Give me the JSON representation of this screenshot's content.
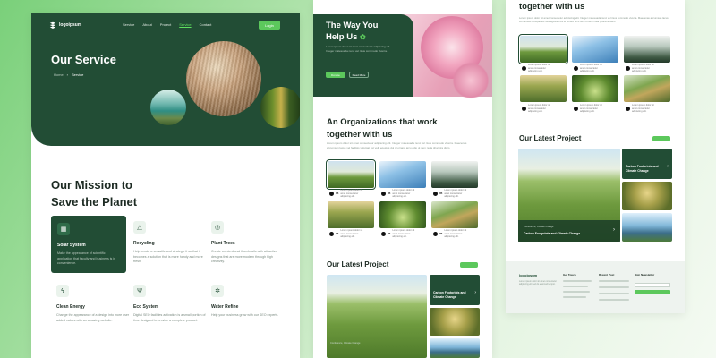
{
  "brand": {
    "name": "logoipsum"
  },
  "nav": {
    "links": [
      "Service",
      "About",
      "Project",
      "Service",
      "Contact"
    ],
    "active_index": 3,
    "cta": "Login"
  },
  "hero1": {
    "title": "Our Service",
    "breadcrumb": [
      "Home",
      "Service"
    ]
  },
  "mission": {
    "title_line1": "Our Mission to",
    "title_line2": "Save the Planet",
    "services": [
      {
        "title": "Solar System",
        "desc": "Make the appearance of scientific application that faculty and business is in convenience.",
        "icon": "solar-panel-icon"
      },
      {
        "title": "Recycling",
        "desc": "Help create a versatile and strategic it so that it becomes a solution that is more handy and more fresh.",
        "icon": "triangle-recycle-icon"
      },
      {
        "title": "Plant Trees",
        "desc": "Create unintentional thumbnails with attractive designs that are more modern through high creativity.",
        "icon": "wifi-tree-icon"
      },
      {
        "title": "Clean Energy",
        "desc": "Change the appearance of a design into more user added values with an amazing website.",
        "icon": "lightning-icon"
      },
      {
        "title": "Eco System",
        "desc": "Digital SEO facilities activation is a small portion of time designed to provide a complete product.",
        "icon": "fork-knife-icon"
      },
      {
        "title": "Water Refine",
        "desc": "Help your business grow with our SEO experts.",
        "icon": "gear-icon"
      }
    ]
  },
  "hero2": {
    "title_line1": "The Way You",
    "title_line2": "Help Us",
    "desc": "Lorem ipsum dolor sit amet consectetur adipiscing elit. Integer malesuada nunc vel risus commodo viverra.",
    "btn_primary": "Donate",
    "btn_secondary": "Read More"
  },
  "org": {
    "title_line1": "An Organizations that work",
    "title_line2": "together with us",
    "desc": "Lorem ipsum dolor sit amet consectetur adipiscing elit. Integer malesuada nunc vel risus commodo viverra. Maecenas accumsan lacus vel facilisis volutpat est velit egestas dui id ornare arcu odio ut sem nulla pharetra diam.",
    "items": [
      {
        "num": "05",
        "caption": "Lorem ipsum dolor sit amet consectetur adipiscing elit."
      },
      {
        "num": "05",
        "caption": "Lorem ipsum dolor sit amet consectetur adipiscing elit."
      },
      {
        "num": "05",
        "caption": "Lorem ipsum dolor sit amet consectetur adipiscing elit."
      },
      {
        "num": "05",
        "caption": "Lorem ipsum dolor sit amet consectetur adipiscing elit."
      },
      {
        "num": "05",
        "caption": "Lorem ipsum dolor sit amet consectetur adipiscing elit."
      },
      {
        "num": "05",
        "caption": "Lorem ipsum dolor sit amet consectetur adipiscing elit."
      }
    ]
  },
  "project": {
    "title": "Our Latest Project",
    "btn": "View All",
    "featured_sub": "Conference, Climate Change",
    "featured_title": "Carbon Footprints and Climate Change",
    "side_title": "Carbon Footprints and Climate Change"
  },
  "footer": {
    "about": "Lorem ipsum dolor sit amet consectetur adipiscing elit sed do eiusmod tempor.",
    "col_touch": "Get Touch",
    "col_recent": "Recent Post",
    "col_newsletter": "Join Newsletter",
    "email_placeholder": "Enter Email",
    "subscribe": "Subscribe"
  },
  "colors": {
    "brand_dark": "#224d35",
    "accent_green": "#5cc85c",
    "text_dark": "#1c2a22"
  }
}
